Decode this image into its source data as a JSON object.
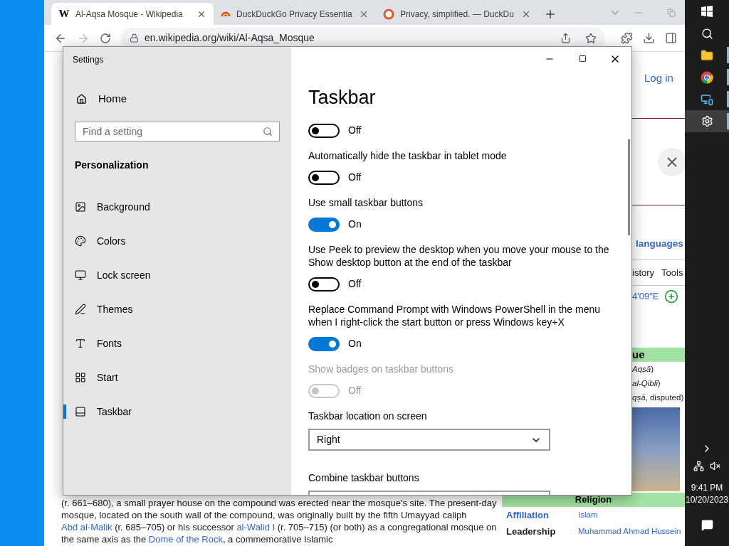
{
  "browser": {
    "tabs": [
      {
        "title": "Al-Aqsa Mosque - Wikipedia",
        "favicon_text": "W",
        "selected": true
      },
      {
        "title": "DuckDuckGo Privacy Essentia",
        "selected": false
      },
      {
        "title": "Privacy, simplified. — DuckDu",
        "selected": false
      }
    ],
    "forward_enabled": false,
    "address": "en.wikipedia.org/wiki/Al-Aqsa_Mosque"
  },
  "wiki": {
    "login": "Log in",
    "languages": "languages",
    "page_tabs": [
      "istory",
      "Tools"
    ],
    "coords": "4'09″E",
    "infobox": {
      "title": "ue",
      "names": [
        "*Aqṣā*)",
        "*al-Qiblī*)",
        "*qṣā*, disputed)"
      ],
      "section": "Religion",
      "rows": [
        {
          "label": "Affiliation",
          "value": "Islam",
          "label_link": true
        },
        {
          "label": "Leadership",
          "value": "Muhammad Ahmad Hussein",
          "label_link": false
        }
      ]
    },
    "paragraph": [
      {
        "text": "(r. 661–680), a small prayer house on the compound was erected near the mosque's site. The present-day mosque, located on the south wall of the compound, was originally built by the fifth Umayyad caliph ",
        "kind": "text"
      },
      {
        "text": "Abd al-Malik",
        "kind": "link"
      },
      {
        "text": " (r. 685–705) or his successor ",
        "kind": "text"
      },
      {
        "text": "al-Walid I",
        "kind": "link"
      },
      {
        "text": " (r. 705–715) (or both) as a congregational mosque on the same axis as the ",
        "kind": "text"
      },
      {
        "text": "Dome of the Rock",
        "kind": "link"
      },
      {
        "text": ", a commemorative Islamic",
        "kind": "text"
      }
    ]
  },
  "settings": {
    "window_title": "Settings",
    "home": "Home",
    "search_placeholder": "Find a setting",
    "section": "Personalization",
    "nav": [
      {
        "label": "Background",
        "selected": false
      },
      {
        "label": "Colors",
        "selected": false
      },
      {
        "label": "Lock screen",
        "selected": false
      },
      {
        "label": "Themes",
        "selected": false
      },
      {
        "label": "Fonts",
        "selected": false
      },
      {
        "label": "Start",
        "selected": false
      },
      {
        "label": "Taskbar",
        "selected": true
      }
    ],
    "page_title": "Taskbar",
    "items": [
      {
        "kind": "toggle",
        "on": false,
        "disabled": false,
        "state_text": "Off"
      },
      {
        "kind": "toggle",
        "label": "Automatically hide the taskbar in tablet mode",
        "on": false,
        "disabled": false,
        "state_text": "Off"
      },
      {
        "kind": "toggle",
        "label": "Use small taskbar buttons",
        "on": true,
        "disabled": false,
        "state_text": "On"
      },
      {
        "kind": "toggle",
        "label": "Use Peek to preview the desktop when you move your mouse to the Show desktop button at the end of the taskbar",
        "on": false,
        "disabled": false,
        "state_text": "Off"
      },
      {
        "kind": "toggle",
        "label": "Replace Command Prompt with Windows PowerShell in the menu when I right-click the start button or press Windows key+X",
        "on": true,
        "disabled": false,
        "state_text": "On"
      },
      {
        "kind": "toggle",
        "label": "Show badges on taskbar buttons",
        "on": false,
        "disabled": true,
        "state_text": "Off"
      },
      {
        "kind": "dropdown",
        "label": "Taskbar location on screen",
        "value": "Right"
      },
      {
        "kind": "dropdown",
        "label": "Combine taskbar buttons"
      }
    ]
  },
  "taskbar": {
    "apps": [
      {
        "running": true,
        "selected": false
      },
      {
        "running": true,
        "selected": false
      },
      {
        "running": true,
        "selected": false
      },
      {
        "running": true,
        "selected": true
      }
    ],
    "time": "9:41 PM",
    "date": "10/20/2023"
  }
}
